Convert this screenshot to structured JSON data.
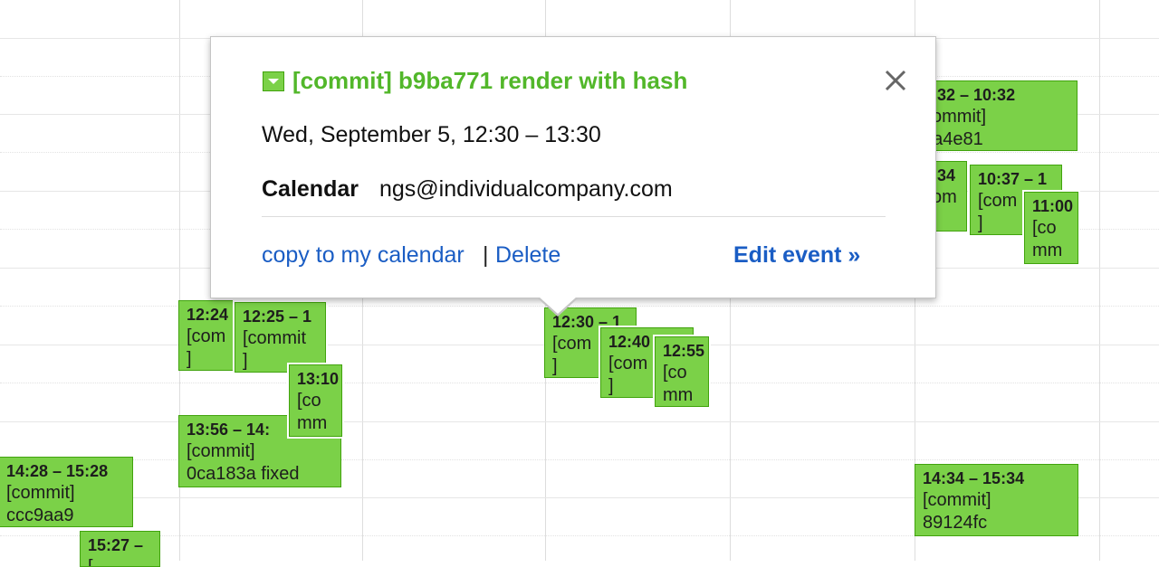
{
  "event_bubble": {
    "title": "[commit] b9ba771 render with hash",
    "when": "Wed, September 5, 12:30 – 13:30",
    "calendar_label": "Calendar",
    "calendar_value": "ngs@individualcompany.com",
    "copy_link": "copy to my calendar",
    "separator": "|",
    "delete_link": "Delete",
    "edit_link": "Edit event »"
  },
  "calendar_events": [
    {
      "time": "12:24",
      "line2": "[com",
      "line3": "]"
    },
    {
      "time": "12:25 – 1",
      "line2": "[commit",
      "line3": "]"
    },
    {
      "time": "13:10",
      "line2": "[co",
      "line3": "mm"
    },
    {
      "time": "13:56 – 14:",
      "line2": "[commit]",
      "line3": "0ca183a fixed"
    },
    {
      "time": "14:28 – 15:28",
      "line2": "[commit]",
      "line3": "ccc9aa9"
    },
    {
      "time": "15:27 –",
      "line2": "[",
      "line3": ""
    },
    {
      "time": "12:30 – 1",
      "line2": "[com",
      "line3": "]"
    },
    {
      "time": "12:40",
      "line2": "[com",
      "line3": "]"
    },
    {
      "time": "12:55",
      "line2": "[co",
      "line3": "mm"
    },
    {
      "time": "9:32 – 10:32",
      "line2": "commit]",
      "line3": "ba4e81"
    },
    {
      "time": "0:34",
      "line2": "com",
      "line3": ""
    },
    {
      "time": "10:37 – 1",
      "line2": "[com",
      "line3": "]"
    },
    {
      "time": "11:00",
      "line2": "[co",
      "line3": "mm"
    },
    {
      "time": "14:34 – 15:34",
      "line2": "[commit]",
      "line3": "89124fc"
    }
  ],
  "colors": {
    "event_fill": "#7bd148",
    "event_border": "#41a30d",
    "title_green": "#52b72a",
    "link_blue": "#1a5dc4"
  },
  "icons": [
    "dropdown-icon",
    "close-icon"
  ]
}
